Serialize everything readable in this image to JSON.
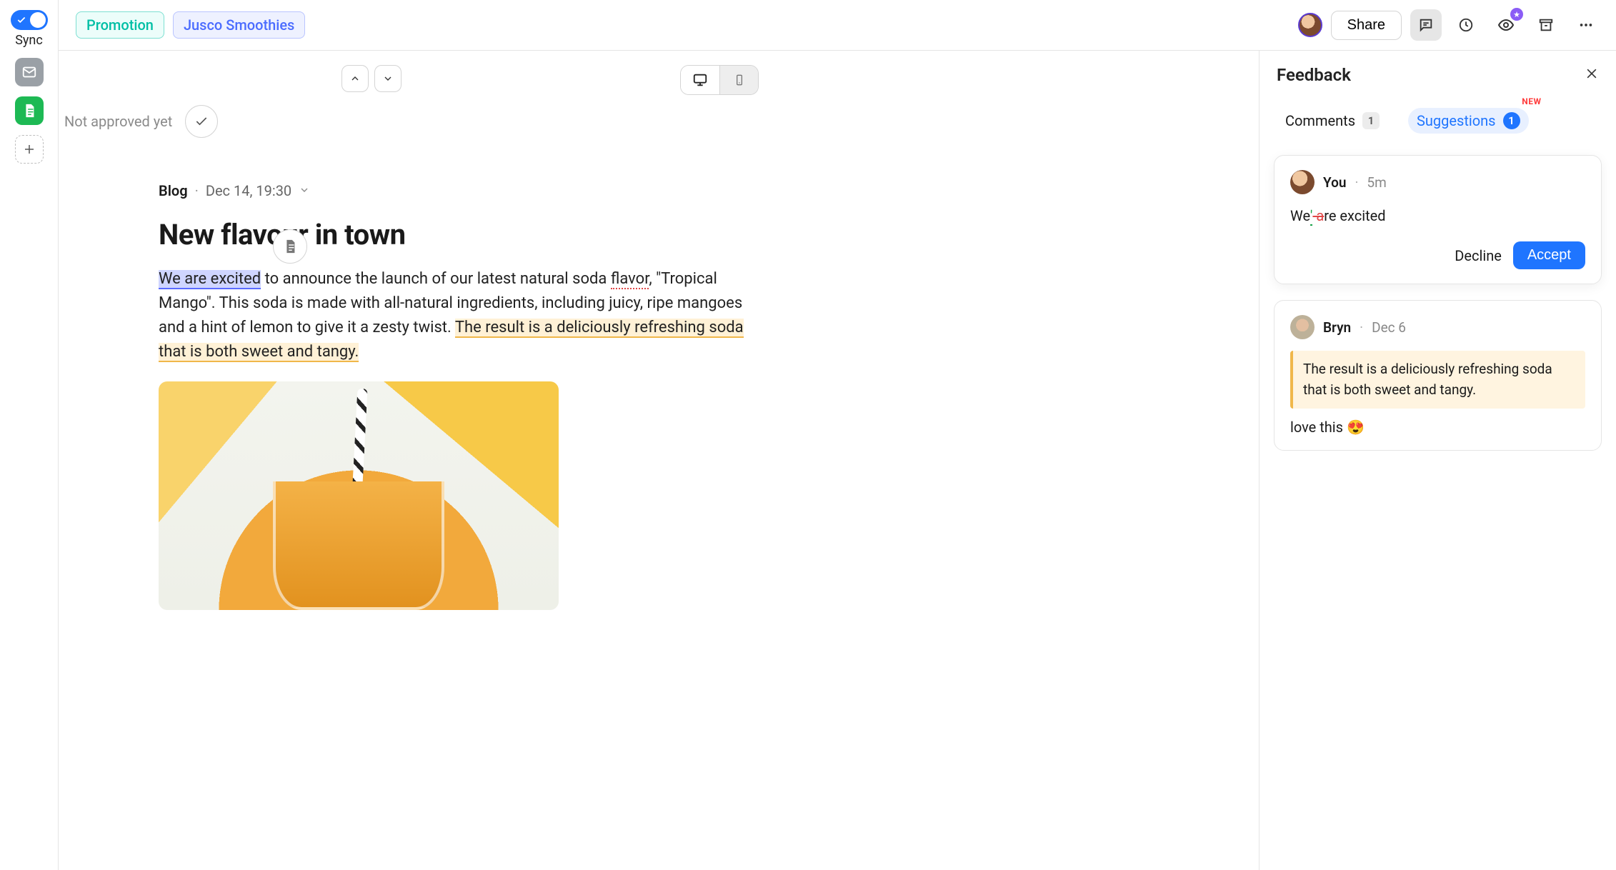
{
  "sidebar": {
    "sync_label": "Sync"
  },
  "topbar": {
    "tag_promotion": "Promotion",
    "tag_campaign": "Jusco Smoothies",
    "share_label": "Share"
  },
  "editor": {
    "approval_text": "Not approved yet",
    "meta_category": "Blog",
    "meta_date": "Dec 14, 19:30",
    "title": "New flavour in town",
    "body": {
      "seg_highlight_suggestion": "We are excited",
      "seg_1": " to announce the launch of our latest natural soda ",
      "seg_spell": "flavor",
      "seg_2": ", \"Tropical Mango\". This soda is made with all-natural ingredients, including juicy, ripe mangoes and a hint of lemon to give it a zesty twist. ",
      "seg_highlight_comment": "The result is a deliciously refreshing soda that is both sweet and tangy."
    }
  },
  "feedback": {
    "panel_title": "Feedback",
    "tabs": {
      "comments_label": "Comments",
      "comments_count": "1",
      "suggestions_label": "Suggestions",
      "suggestions_count": "1",
      "new_badge": "NEW"
    },
    "suggestion_card": {
      "author": "You",
      "time": "5m",
      "text_prefix": "We",
      "text_insert": "'",
      "text_delete": " a",
      "text_suffix": "re excited",
      "decline_label": "Decline",
      "accept_label": "Accept"
    },
    "comment_card": {
      "author": "Bryn",
      "time": "Dec 6",
      "quote": "The result is a deliciously refreshing soda that is both sweet and tangy.",
      "body": "love this 😍"
    }
  }
}
